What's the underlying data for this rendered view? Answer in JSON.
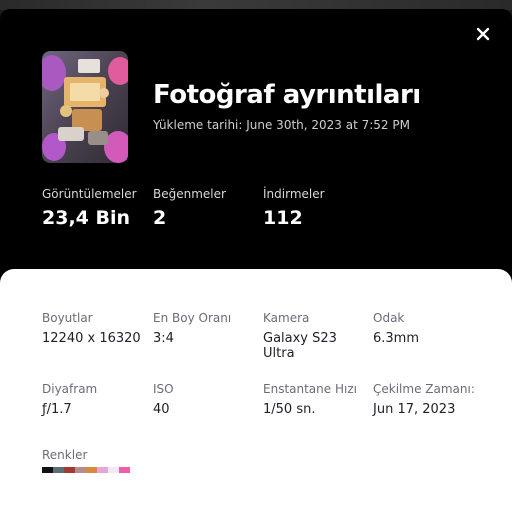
{
  "dialog": {
    "title": "Fotoğraf ayrıntıları",
    "upload_date": "Yükleme tarihi: June 30th, 2023 at 7:52 PM",
    "close_icon": "close-icon"
  },
  "stats": [
    {
      "label": "Görüntülemeler",
      "value": "23,4 Bin"
    },
    {
      "label": "Beğenmeler",
      "value": "2"
    },
    {
      "label": "İndirmeler",
      "value": "112"
    }
  ],
  "details": [
    {
      "label": "Boyutlar",
      "value": "12240 x 16320"
    },
    {
      "label": "En Boy Oranı",
      "value": "3:4"
    },
    {
      "label": "Kamera",
      "value": "Galaxy S23 Ultra"
    },
    {
      "label": "Odak",
      "value": "6.3mm"
    },
    {
      "label": "Diyafram",
      "value": "ƒ/1.7"
    },
    {
      "label": "ISO",
      "value": "40"
    },
    {
      "label": "Enstantane Hızı",
      "value": "1/50 sn."
    },
    {
      "label": "Çekilme Zamanı:",
      "value": "Jun 17, 2023"
    }
  ],
  "colors": {
    "label": "Renkler",
    "swatches": [
      "#111111",
      "#5e6e78",
      "#a33a32",
      "#b88c8c",
      "#d88a3a",
      "#e6a6d8",
      "#f3e8f5",
      "#ee5fa8"
    ]
  }
}
